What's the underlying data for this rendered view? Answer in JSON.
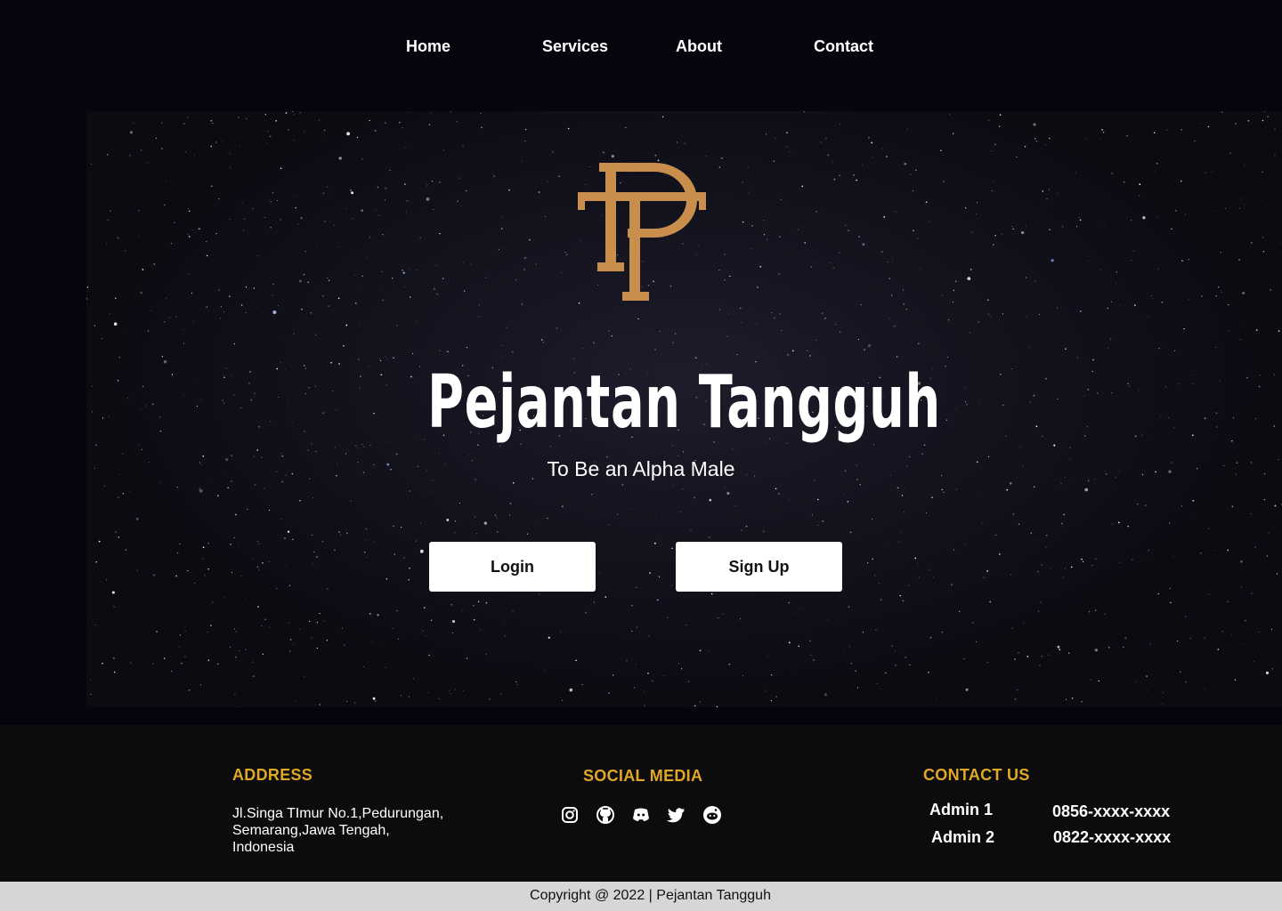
{
  "nav": {
    "items": [
      {
        "label": "Home"
      },
      {
        "label": "Services"
      },
      {
        "label": "About"
      },
      {
        "label": "Contact"
      }
    ]
  },
  "hero": {
    "logo_letters": "PT",
    "title": "Pejantan Tangguh",
    "subtitle": "To Be an Alpha Male",
    "login_label": "Login",
    "signup_label": "Sign Up"
  },
  "footer": {
    "address": {
      "heading": "ADDRESS",
      "lines": [
        "Jl.Singa TImur No.1,Pedurungan,",
        "Semarang,Jawa Tengah,",
        "Indonesia"
      ]
    },
    "social": {
      "heading": "SOCIAL MEDIA",
      "icons": [
        "instagram-icon",
        "github-icon",
        "discord-icon",
        "twitter-icon",
        "reddit-icon"
      ]
    },
    "contact": {
      "heading": "CONTACT US",
      "admins": [
        {
          "name": "Admin  1",
          "phone": "0856-xxxx-xxxx"
        },
        {
          "name": "Admin 2",
          "phone": "0822-xxxx-xxxx"
        }
      ]
    }
  },
  "copyright": "Copyright @ 2022 | Pejantan Tangguh",
  "colors": {
    "background": "#05050d",
    "accent": "#e0a825",
    "logo": "#c98e4b",
    "footer_bar": "#d6d6d6"
  }
}
